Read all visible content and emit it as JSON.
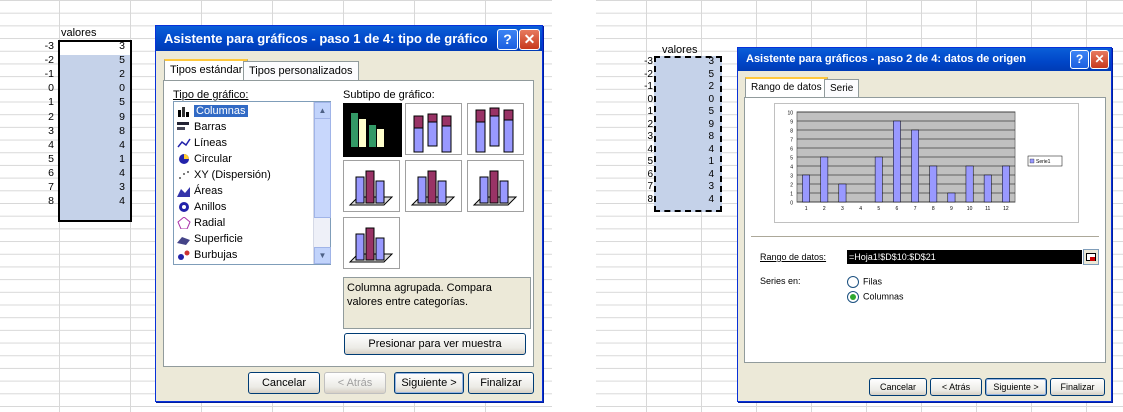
{
  "left_sheet": {
    "header": "valores",
    "rows": [
      {
        "label": "-3",
        "value": "3"
      },
      {
        "label": "-2",
        "value": "5"
      },
      {
        "label": "-1",
        "value": "2"
      },
      {
        "label": "0",
        "value": "0"
      },
      {
        "label": "1",
        "value": "5"
      },
      {
        "label": "2",
        "value": "9"
      },
      {
        "label": "3",
        "value": "8"
      },
      {
        "label": "4",
        "value": "4"
      },
      {
        "label": "5",
        "value": "1"
      },
      {
        "label": "6",
        "value": "4"
      },
      {
        "label": "7",
        "value": "3"
      },
      {
        "label": "8",
        "value": "4"
      }
    ]
  },
  "wizard1": {
    "title": "Asistente para gráficos - paso 1 de 4: tipo de gráfico",
    "help": "?",
    "close": "✕",
    "tabs": [
      "Tipos estándar",
      "Tipos personalizados"
    ],
    "chart_type_label": "Tipo de gráfico:",
    "subtype_label": "Subtipo de gráfico:",
    "chart_types": [
      "Columnas",
      "Barras",
      "Líneas",
      "Circular",
      "XY (Dispersión)",
      "Áreas",
      "Anillos",
      "Radial",
      "Superficie",
      "Burbujas"
    ],
    "description": "Columna agrupada. Compara valores entre categorías.",
    "preview_button": "Presionar para ver muestra",
    "buttons": {
      "cancel": "Cancelar",
      "back": "< Atrás",
      "next": "Siguiente >",
      "finish": "Finalizar"
    }
  },
  "right_sheet": {
    "header": "valores",
    "rows": [
      {
        "label": "-3",
        "value": "3"
      },
      {
        "label": "-2",
        "value": "5"
      },
      {
        "label": "-1",
        "value": "2"
      },
      {
        "label": "0",
        "value": "0"
      },
      {
        "label": "1",
        "value": "5"
      },
      {
        "label": "2",
        "value": "9"
      },
      {
        "label": "3",
        "value": "8"
      },
      {
        "label": "4",
        "value": "4"
      },
      {
        "label": "5",
        "value": "1"
      },
      {
        "label": "6",
        "value": "4"
      },
      {
        "label": "7",
        "value": "3"
      },
      {
        "label": "8",
        "value": "4"
      }
    ]
  },
  "wizard2": {
    "title": "Asistente para gráficos - paso 2 de 4: datos de origen",
    "help": "?",
    "close": "✕",
    "tabs": [
      "Rango de datos",
      "Serie"
    ],
    "range_label": "Rango de datos:",
    "range_value": "=Hoja1!$D$10:$D$21",
    "series_in_label": "Series en:",
    "option_rows": "Filas",
    "option_columns": "Columnas",
    "buttons": {
      "cancel": "Cancelar",
      "back": "< Atrás",
      "next": "Siguiente >",
      "finish": "Finalizar"
    }
  },
  "chart_data": {
    "type": "bar",
    "categories": [
      "1",
      "2",
      "3",
      "4",
      "5",
      "6",
      "7",
      "8",
      "9",
      "10",
      "11",
      "12"
    ],
    "values": [
      3,
      5,
      2,
      0,
      5,
      9,
      8,
      4,
      1,
      4,
      3,
      4
    ],
    "yticks": [
      "0",
      "1",
      "2",
      "3",
      "4",
      "5",
      "6",
      "7",
      "8",
      "9",
      "10"
    ],
    "ylim": [
      0,
      10
    ],
    "legend": "Serie1",
    "legend_position": "right",
    "grid": true
  },
  "colors": {
    "title": "#0046c8",
    "bar": "#9999ff",
    "selection": "#316ac5",
    "plot_bg": "#c0c0c0"
  }
}
